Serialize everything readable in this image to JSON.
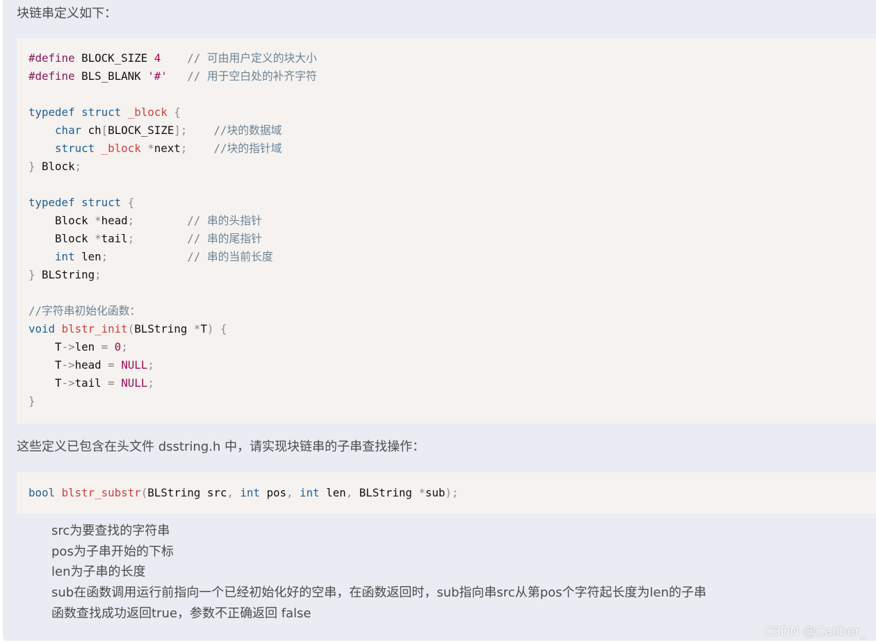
{
  "intro_text": "块链串定义如下：",
  "code_block_1": {
    "lines": [
      [
        {
          "c": "pp",
          "t": "#define"
        },
        {
          "c": "plain",
          "t": " BLOCK_SIZE "
        },
        {
          "c": "nm",
          "t": "4"
        },
        {
          "c": "plain",
          "t": "    "
        },
        {
          "c": "cm",
          "t": "// 可由用户定义的块大小"
        }
      ],
      [
        {
          "c": "pp",
          "t": "#define"
        },
        {
          "c": "plain",
          "t": " BLS_BLANK "
        },
        {
          "c": "nm",
          "t": "'#'"
        },
        {
          "c": "plain",
          "t": "   "
        },
        {
          "c": "cm",
          "t": "// 用于空白处的补齐字符"
        }
      ],
      [],
      [
        {
          "c": "kw",
          "t": "typedef"
        },
        {
          "c": "plain",
          "t": " "
        },
        {
          "c": "kw",
          "t": "struct"
        },
        {
          "c": "plain",
          "t": " "
        },
        {
          "c": "fn",
          "t": "_block"
        },
        {
          "c": "plain",
          "t": " "
        },
        {
          "c": "pn",
          "t": "{"
        }
      ],
      [
        {
          "c": "plain",
          "t": "    "
        },
        {
          "c": "kw",
          "t": "char"
        },
        {
          "c": "plain",
          "t": " ch"
        },
        {
          "c": "pn",
          "t": "["
        },
        {
          "c": "plain",
          "t": "BLOCK_SIZE"
        },
        {
          "c": "pn",
          "t": "];"
        },
        {
          "c": "plain",
          "t": "    "
        },
        {
          "c": "cm",
          "t": "//块的数据域"
        }
      ],
      [
        {
          "c": "plain",
          "t": "    "
        },
        {
          "c": "kw",
          "t": "struct"
        },
        {
          "c": "plain",
          "t": " "
        },
        {
          "c": "fn",
          "t": "_block"
        },
        {
          "c": "plain",
          "t": " "
        },
        {
          "c": "op",
          "t": "*"
        },
        {
          "c": "plain",
          "t": "next"
        },
        {
          "c": "pn",
          "t": ";"
        },
        {
          "c": "plain",
          "t": "    "
        },
        {
          "c": "cm",
          "t": "//块的指针域"
        }
      ],
      [
        {
          "c": "pn",
          "t": "}"
        },
        {
          "c": "plain",
          "t": " Block"
        },
        {
          "c": "pn",
          "t": ";"
        }
      ],
      [],
      [
        {
          "c": "kw",
          "t": "typedef"
        },
        {
          "c": "plain",
          "t": " "
        },
        {
          "c": "kw",
          "t": "struct"
        },
        {
          "c": "plain",
          "t": " "
        },
        {
          "c": "pn",
          "t": "{"
        }
      ],
      [
        {
          "c": "plain",
          "t": "    Block "
        },
        {
          "c": "op",
          "t": "*"
        },
        {
          "c": "plain",
          "t": "head"
        },
        {
          "c": "pn",
          "t": ";"
        },
        {
          "c": "plain",
          "t": "        "
        },
        {
          "c": "cm",
          "t": "// 串的头指针"
        }
      ],
      [
        {
          "c": "plain",
          "t": "    Block "
        },
        {
          "c": "op",
          "t": "*"
        },
        {
          "c": "plain",
          "t": "tail"
        },
        {
          "c": "pn",
          "t": ";"
        },
        {
          "c": "plain",
          "t": "        "
        },
        {
          "c": "cm",
          "t": "// 串的尾指针"
        }
      ],
      [
        {
          "c": "plain",
          "t": "    "
        },
        {
          "c": "kw",
          "t": "int"
        },
        {
          "c": "plain",
          "t": " len"
        },
        {
          "c": "pn",
          "t": ";"
        },
        {
          "c": "plain",
          "t": "            "
        },
        {
          "c": "cm",
          "t": "// 串的当前长度"
        }
      ],
      [
        {
          "c": "pn",
          "t": "}"
        },
        {
          "c": "plain",
          "t": " BLString"
        },
        {
          "c": "pn",
          "t": ";"
        }
      ],
      [],
      [
        {
          "c": "cm",
          "t": "//字符串初始化函数："
        }
      ],
      [
        {
          "c": "kw",
          "t": "void"
        },
        {
          "c": "plain",
          "t": " "
        },
        {
          "c": "fn",
          "t": "blstr_init"
        },
        {
          "c": "pn",
          "t": "("
        },
        {
          "c": "plain",
          "t": "BLString "
        },
        {
          "c": "op",
          "t": "*"
        },
        {
          "c": "plain",
          "t": "T"
        },
        {
          "c": "pn",
          "t": ")"
        },
        {
          "c": "plain",
          "t": " "
        },
        {
          "c": "pn",
          "t": "{"
        }
      ],
      [
        {
          "c": "plain",
          "t": "    T"
        },
        {
          "c": "op",
          "t": "->"
        },
        {
          "c": "plain",
          "t": "len "
        },
        {
          "c": "op",
          "t": "="
        },
        {
          "c": "plain",
          "t": " "
        },
        {
          "c": "nm",
          "t": "0"
        },
        {
          "c": "pn",
          "t": ";"
        }
      ],
      [
        {
          "c": "plain",
          "t": "    T"
        },
        {
          "c": "op",
          "t": "->"
        },
        {
          "c": "plain",
          "t": "head "
        },
        {
          "c": "op",
          "t": "="
        },
        {
          "c": "plain",
          "t": " "
        },
        {
          "c": "nm",
          "t": "NULL"
        },
        {
          "c": "pn",
          "t": ";"
        }
      ],
      [
        {
          "c": "plain",
          "t": "    T"
        },
        {
          "c": "op",
          "t": "->"
        },
        {
          "c": "plain",
          "t": "tail "
        },
        {
          "c": "op",
          "t": "="
        },
        {
          "c": "plain",
          "t": " "
        },
        {
          "c": "nm",
          "t": "NULL"
        },
        {
          "c": "pn",
          "t": ";"
        }
      ],
      [
        {
          "c": "pn",
          "t": "}"
        }
      ]
    ]
  },
  "middle_text": "这些定义已包含在头文件 dsstring.h 中，请实现块链串的子串查找操作：",
  "code_block_2": {
    "lines": [
      [
        {
          "c": "kw",
          "t": "bool"
        },
        {
          "c": "plain",
          "t": " "
        },
        {
          "c": "fn",
          "t": "blstr_substr"
        },
        {
          "c": "pn",
          "t": "("
        },
        {
          "c": "plain",
          "t": "BLString src"
        },
        {
          "c": "pn",
          "t": ","
        },
        {
          "c": "plain",
          "t": " "
        },
        {
          "c": "kw",
          "t": "int"
        },
        {
          "c": "plain",
          "t": " pos"
        },
        {
          "c": "pn",
          "t": ","
        },
        {
          "c": "plain",
          "t": " "
        },
        {
          "c": "kw",
          "t": "int"
        },
        {
          "c": "plain",
          "t": " len"
        },
        {
          "c": "pn",
          "t": ","
        },
        {
          "c": "plain",
          "t": " BLString "
        },
        {
          "c": "op",
          "t": "*"
        },
        {
          "c": "plain",
          "t": "sub"
        },
        {
          "c": "pn",
          "t": ");"
        }
      ]
    ]
  },
  "param_notes": [
    "src为要查找的字符串",
    "pos为子串开始的下标",
    "len为子串的长度",
    "sub在函数调用运行前指向一个已经初始化好的空串，在函数返回时，sub指向串src从第pos个字符起长度为len的子串",
    "函数查找成功返回true，参数不正确返回 false"
  ],
  "watermark": "CSDN @Caliber_"
}
